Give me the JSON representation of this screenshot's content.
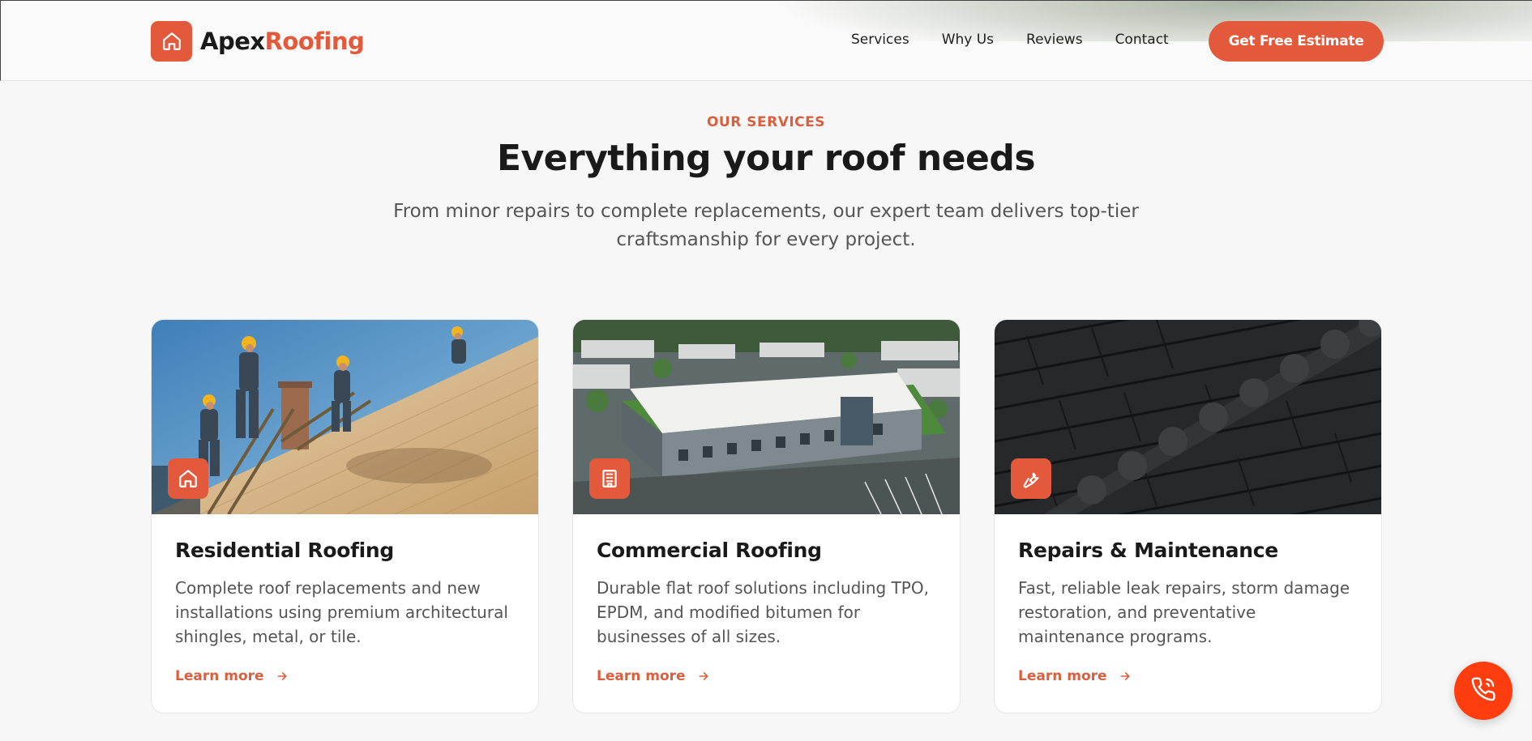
{
  "brand": {
    "name_part1": "Apex",
    "name_part2": "Roofing",
    "accent": "#e25a3b"
  },
  "nav": {
    "items": [
      "Services",
      "Why Us",
      "Reviews",
      "Contact"
    ],
    "cta_label": "Get Free Estimate"
  },
  "section": {
    "eyebrow": "OUR SERVICES",
    "title": "Everything your roof needs",
    "subtitle": "From minor repairs to complete replacements, our expert team delivers top-tier craftsmanship for every project."
  },
  "cards": [
    {
      "icon": "home-icon",
      "title": "Residential Roofing",
      "description": "Complete roof replacements and new installations using premium architectural shingles, metal, or tile.",
      "link": "Learn more"
    },
    {
      "icon": "building-icon",
      "title": "Commercial Roofing",
      "description": "Durable flat roof solutions including TPO, EPDM, and modified bitumen for businesses of all sizes.",
      "link": "Learn more"
    },
    {
      "icon": "wrench-icon",
      "title": "Repairs & Maintenance",
      "description": "Fast, reliable leak repairs, storm damage restoration, and preventative maintenance programs.",
      "link": "Learn more"
    }
  ],
  "fab": {
    "icon": "phone-icon"
  }
}
